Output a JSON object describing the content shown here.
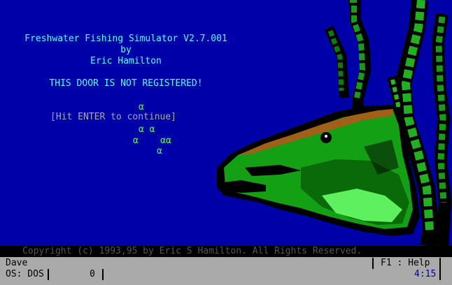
{
  "title_line": "Freshwater Fishing Simulator V2.7.001",
  "by_line": "by",
  "author_line": "Eric Hamilton",
  "notice": "THIS DOOR IS NOT REGISTERED!",
  "bubble_1": "α",
  "prompt": "[Hit ENTER to continue]",
  "bubble_2": "α α",
  "bubble_3": "α    αα",
  "bubble_4": "α",
  "copyright": "Copyright (c) 1993,95 by Eric S Hamilton. All Rights Reserved.",
  "status": {
    "user": "Dave",
    "os": "OS: DOS",
    "counter": "0",
    "help": "F1 : Help",
    "time": "4:15"
  },
  "colors": {
    "background": "#0000a8",
    "title_text": "#55ffff",
    "bubbles": "#55ff55",
    "status_bar": "#aaaaaa",
    "time_text": "#0000a8",
    "copyright_text": "#555555"
  },
  "icons": [
    "seaweed-icon",
    "bass-fish-icon"
  ]
}
